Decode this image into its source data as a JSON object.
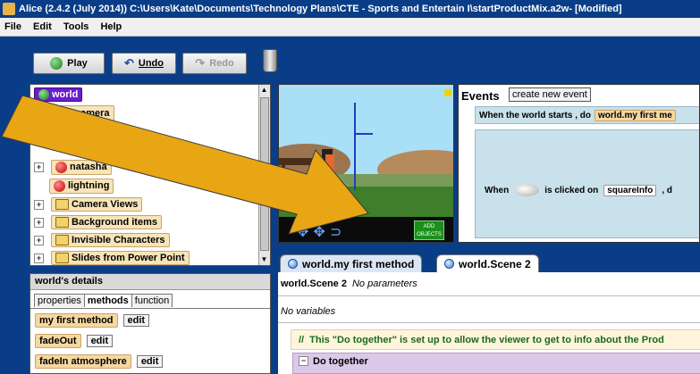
{
  "window": {
    "title": "Alice (2.4.2 (July 2014)) C:\\Users\\Kate\\Documents\\Technology Plans\\CTE - Sports and Entertain I\\startProductMix.a2w-  [Modified]"
  },
  "menu": {
    "items": [
      "File",
      "Edit",
      "Tools",
      "Help"
    ]
  },
  "toolbar": {
    "play_label": "Play",
    "undo_label": "Undo",
    "redo_label": "Redo"
  },
  "object_tree": {
    "items": [
      {
        "label": "world",
        "selected": true
      },
      {
        "label": "camera"
      },
      {
        "label": "natasha"
      },
      {
        "label": "lightning"
      },
      {
        "label": "Camera Views"
      },
      {
        "label": "Background items"
      },
      {
        "label": "Invisible Characters"
      },
      {
        "label": "Slides from Power Point"
      }
    ]
  },
  "scene": {
    "add_objects_label": "ADD\nOBJECTS"
  },
  "details": {
    "title": "world's details",
    "tabs": [
      "properties",
      "methods",
      "function"
    ],
    "methods": [
      {
        "name": "my first method",
        "edit": "edit"
      },
      {
        "name": "fadeOut",
        "edit": "edit"
      },
      {
        "name": "fadeIn  atmosphere",
        "edit": "edit"
      }
    ]
  },
  "events": {
    "title": "Events",
    "create_button": "create new event",
    "world_starts": {
      "prefix": "When the world starts ,  do",
      "method": "world.my first me"
    },
    "clicked": {
      "when": "When",
      "middle": "is clicked on",
      "target": "squareInfo",
      "suffix": ", d"
    }
  },
  "editor": {
    "tabs": [
      "world.my first method",
      "world.Scene 2"
    ],
    "active_tab": "world.Scene 2",
    "method_name": "world.Scene 2",
    "params_text": "No parameters",
    "vars_text": "No variables",
    "comment_slashes": "//",
    "comment": "This \"Do together\" is set up to allow the viewer to get to info about the Prod",
    "do_together": "Do together"
  },
  "colors": {
    "accent": "#0a3d87",
    "selected": "#6b1ccf",
    "tile": "#f6d7a0",
    "event_bg": "#c9e1ea",
    "comment": "#1a6b1a"
  }
}
